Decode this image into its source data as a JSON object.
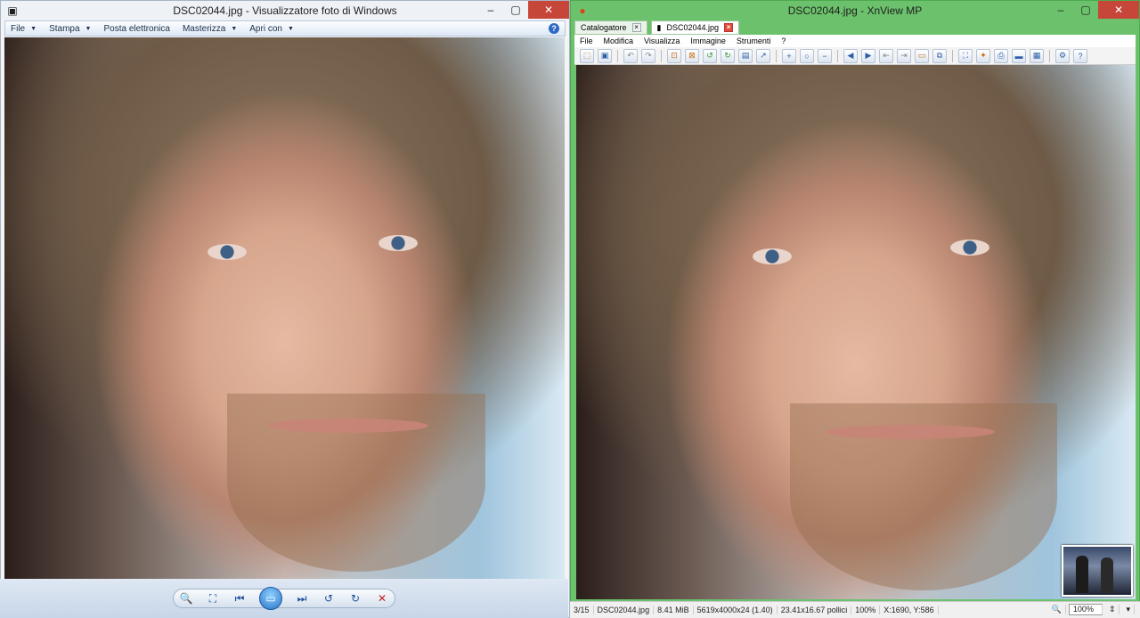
{
  "wpv": {
    "title": "DSC02044.jpg - Visualizzatore foto di Windows",
    "menu": [
      "File",
      "Stampa",
      "Posta elettronica",
      "Masterizza",
      "Apri con"
    ],
    "help": "?"
  },
  "xnview": {
    "title": "DSC02044.jpg - XnView MP",
    "tabs": [
      {
        "label": "Catalogatore",
        "close": "×"
      },
      {
        "label": "DSC02044.jpg",
        "close": "×"
      }
    ],
    "menu": [
      "File",
      "Modifica",
      "Visualizza",
      "Immagine",
      "Strumenti",
      "?"
    ],
    "status": {
      "index": "3/15",
      "filename": "DSC02044.jpg",
      "size": "8.41 MiB",
      "dims": "5619x4000x24 (1.40)",
      "print": "23.41x16.67 pollici",
      "zoom": "100%",
      "pos": "X:1690, Y:586",
      "zoom_box": "100%"
    }
  },
  "colors": {
    "xnview_frame": "#6cc26c",
    "close_button": "#c7463a",
    "accent_blue": "#2a73c8"
  }
}
